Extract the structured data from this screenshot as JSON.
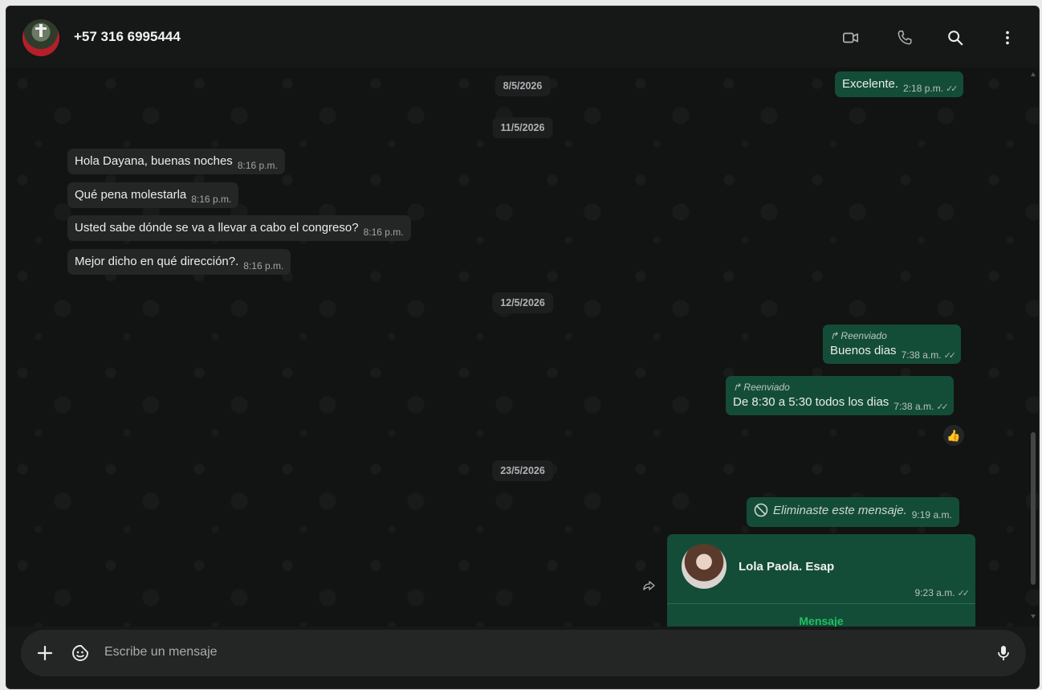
{
  "header": {
    "contact_name": "+57 316 6995444",
    "icons": [
      "video-call-icon",
      "voice-call-icon",
      "search-icon",
      "menu-dots-icon"
    ]
  },
  "messages": {
    "date_1": "8/5/2026",
    "date_2": "11/5/2026",
    "date_3": "12/5/2026",
    "date_4": "23/5/2026",
    "m1": {
      "text": "Excelente.",
      "time": "2:18 p.m."
    },
    "m2": {
      "text": "Hola Dayana, buenas noches",
      "time": "8:16 p.m."
    },
    "m3": {
      "text": "Qué pena molestarla",
      "time": "8:16 p.m."
    },
    "m4": {
      "text": "Usted sabe dónde se va a llevar a cabo el congreso?",
      "time": "8:16 p.m."
    },
    "m5": {
      "text": "Mejor dicho en qué dirección?.",
      "time": "8:16 p.m."
    },
    "m6": {
      "forwarded_label": "Reenviado",
      "text": "Buenos dias",
      "time": "7:38 a.m."
    },
    "m7": {
      "forwarded_label": "Reenviado",
      "text": "De 8:30 a 5:30 todos los dias",
      "time": "7:38 a.m.",
      "reaction": "👍"
    },
    "m8": {
      "text": "Eliminaste este mensaje.",
      "time": "9:19 a.m."
    },
    "contact_card": {
      "name": "Lola Paola. Esap",
      "time": "9:23 a.m.",
      "action": "Mensaje"
    }
  },
  "composer": {
    "placeholder": "Escribe un mensaje",
    "icons": [
      "plus-icon",
      "sticker-icon",
      "microphone-icon"
    ]
  },
  "colors": {
    "incoming_bubble": "#242626",
    "outgoing_bubble": "#144d37",
    "accent": "#21c063",
    "background": "#121313"
  }
}
